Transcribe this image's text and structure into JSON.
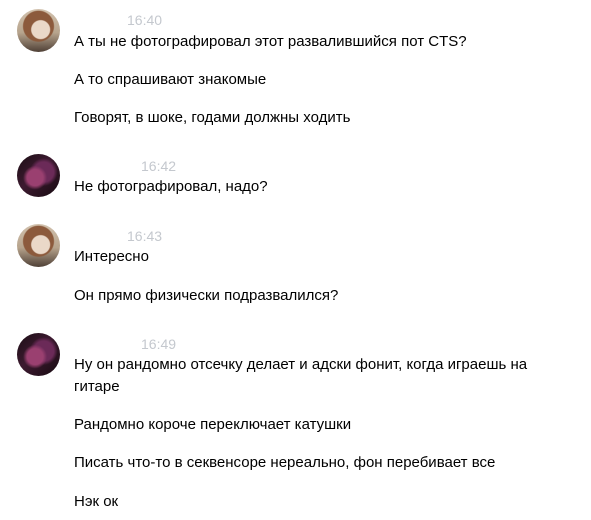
{
  "conversation": [
    {
      "sender": "user-a",
      "time": "16:40",
      "lines": [
        "А ты не фотографировал этот развалившийся пот CTS?",
        "А то спрашивают знакомые",
        "Говорят, в шоке, годами должны ходить"
      ]
    },
    {
      "sender": "user-b",
      "time": "16:42",
      "lines": [
        "Не фотографировал, надо?"
      ]
    },
    {
      "sender": "user-a",
      "time": "16:43",
      "lines": [
        "Интересно",
        "Он прямо физически подразвалился?"
      ]
    },
    {
      "sender": "user-b",
      "time": "16:49",
      "lines": [
        "Ну он рандомно отсечку делает и адски фонит, когда играешь на гитаре",
        "Рандомно короче переключает катушки",
        "Писать что-то в секвенсоре нереально, фон перебивает все",
        "Нэк ок"
      ]
    }
  ],
  "colors": {
    "time_text": "#c4c8ce",
    "message_text": "#000000",
    "background": "#ffffff"
  }
}
